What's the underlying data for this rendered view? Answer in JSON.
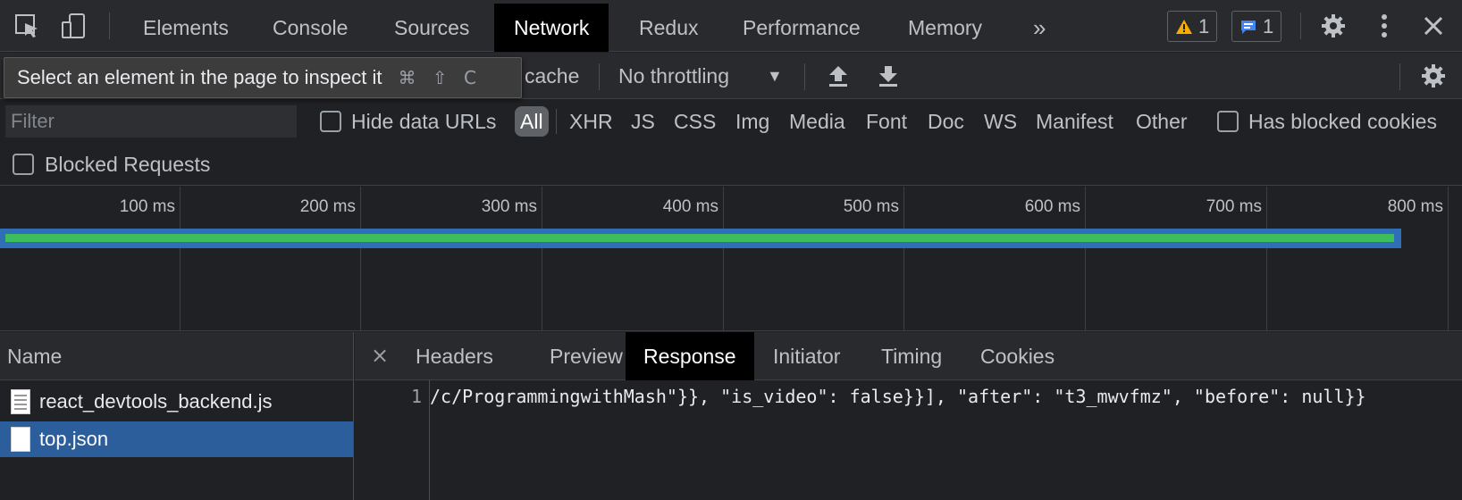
{
  "topbar": {
    "tabs": [
      "Elements",
      "Console",
      "Sources",
      "Network",
      "Redux",
      "Performance",
      "Memory"
    ],
    "active_tab": "Network",
    "more_label": "»",
    "warnings_count": "1",
    "messages_count": "1"
  },
  "toolbar": {
    "tooltip_text": "Select an element in the page to inspect it",
    "tooltip_keys": "⌘ ⇧ C",
    "cache_label": "cache",
    "throttle_value": "No throttling"
  },
  "filterbar": {
    "filter_placeholder": "Filter",
    "hide_data_urls_label": "Hide data URLs",
    "types": [
      "All",
      "XHR",
      "JS",
      "CSS",
      "Img",
      "Media",
      "Font",
      "Doc",
      "WS",
      "Manifest",
      "Other"
    ],
    "active_type": "All",
    "has_blocked_cookies_label": "Has blocked cookies",
    "blocked_requests_label": "Blocked Requests"
  },
  "timeline": {
    "ticks": [
      "100 ms",
      "200 ms",
      "300 ms",
      "400 ms",
      "500 ms",
      "600 ms",
      "700 ms",
      "800 ms"
    ]
  },
  "requests": {
    "column_header": "Name",
    "rows": [
      {
        "name": "react_devtools_backend.js",
        "selected": false
      },
      {
        "name": "top.json",
        "selected": true
      }
    ]
  },
  "details": {
    "close_label": "×",
    "tabs": [
      "Headers",
      "Preview",
      "Response",
      "Initiator",
      "Timing",
      "Cookies"
    ],
    "active_tab": "Response",
    "line_number": "1",
    "response_text": "/c/ProgrammingwithMash\"}}, \"is_video\": false}}], \"after\": \"t3_mwvfmz\", \"before\": null}}"
  },
  "colors": {
    "accent_selected_row": "#2c5e9b",
    "timeline_green": "#3dbd5d",
    "timeline_blue": "#2f6fb7"
  }
}
